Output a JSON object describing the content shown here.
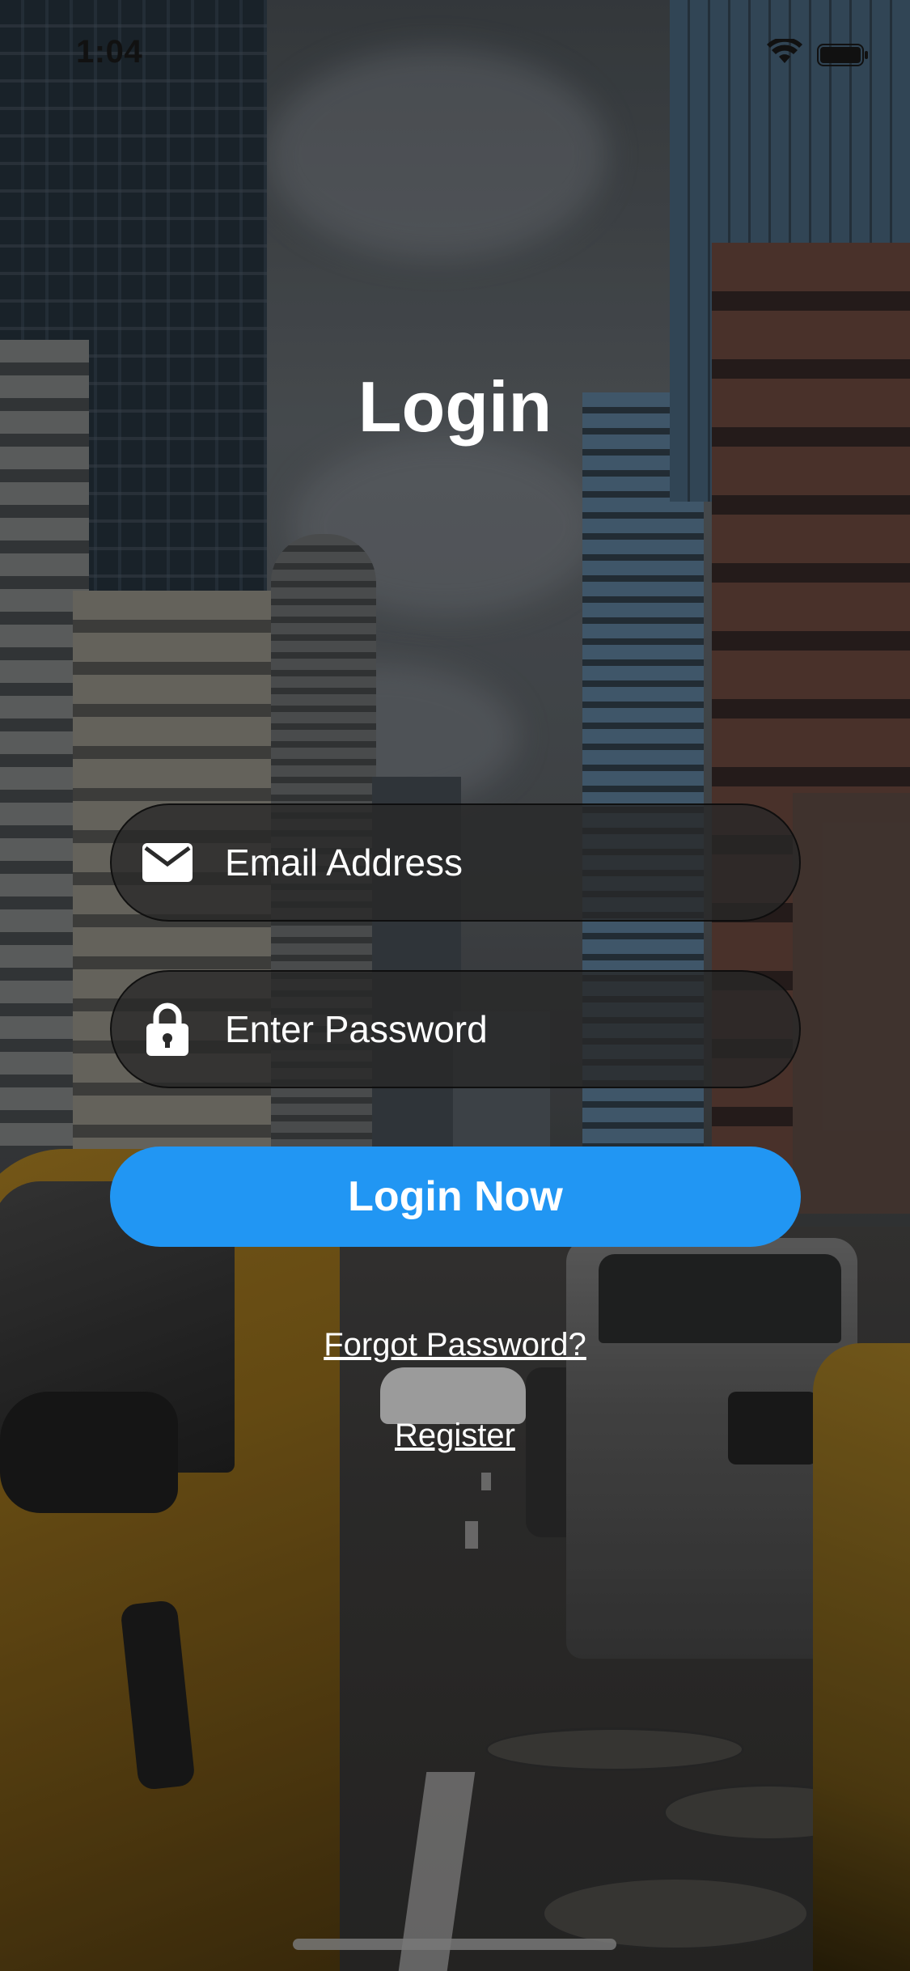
{
  "status_bar": {
    "time": "1:04",
    "wifi_icon": "wifi-icon",
    "battery_icon": "battery-icon"
  },
  "title": "Login",
  "email": {
    "placeholder": "Email Address",
    "value": "",
    "icon": "envelope-icon"
  },
  "password": {
    "placeholder": "Enter Password",
    "value": "",
    "icon": "lock-icon"
  },
  "login_button": {
    "label": "Login Now",
    "color": "#2196f3"
  },
  "links": {
    "forgot_password": "Forgot Password?",
    "register": "Register"
  }
}
